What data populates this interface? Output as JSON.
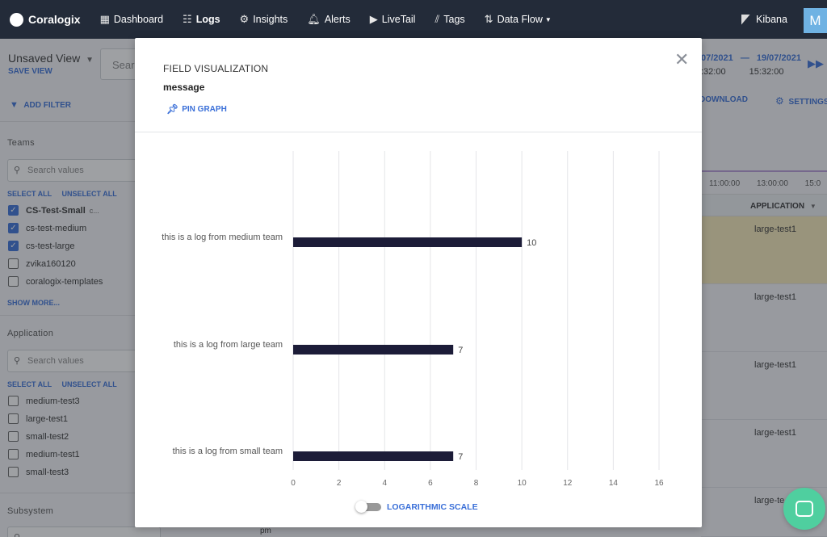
{
  "nav": {
    "brand": "Coralogix",
    "items": [
      {
        "label": "Dashboard",
        "icon": "grid-icon"
      },
      {
        "label": "Logs",
        "icon": "logs-icon",
        "active": true
      },
      {
        "label": "Insights",
        "icon": "chip-icon"
      },
      {
        "label": "Alerts",
        "icon": "bell-icon"
      },
      {
        "label": "LiveTail",
        "icon": "play-icon"
      },
      {
        "label": "Tags",
        "icon": "tags-icon"
      },
      {
        "label": "Data Flow",
        "icon": "dataflow-icon"
      }
    ],
    "kibana": "Kibana",
    "avatar": "M"
  },
  "sidebar": {
    "view_name": "Unsaved View",
    "save_view": "SAVE VIEW",
    "add_filter": "ADD FILTER",
    "teams": {
      "title": "Teams",
      "search_placeholder": "Search values",
      "select_all": "SELECT ALL",
      "unselect_all": "UNSELECT ALL",
      "items": [
        {
          "label": "CS-Test-Small",
          "suffix": "c...",
          "checked": true,
          "bold": true
        },
        {
          "label": "cs-test-medium",
          "checked": true
        },
        {
          "label": "cs-test-large",
          "checked": true
        },
        {
          "label": "zvika160120",
          "checked": false
        },
        {
          "label": "coralogix-templates",
          "checked": false
        }
      ],
      "show_more": "SHOW MORE..."
    },
    "application": {
      "title": "Application",
      "search_placeholder": "Search values",
      "select_all": "SELECT ALL",
      "unselect_all": "UNSELECT ALL",
      "items": [
        {
          "label": "medium-test3",
          "checked": false
        },
        {
          "label": "large-test1",
          "checked": false
        },
        {
          "label": "small-test2",
          "checked": false
        },
        {
          "label": "medium-test1",
          "checked": false
        },
        {
          "label": "small-test3",
          "checked": false
        }
      ]
    },
    "subsystem": {
      "title": "Subsystem"
    }
  },
  "main": {
    "search_placeholder": "Sear",
    "date_from": "07/2021",
    "date_to": "19/07/2021",
    "time_from": ":32:00",
    "time_to": "15:32:00",
    "download": "DOWNLOAD",
    "settings": "SETTINGS",
    "timeline_labels": "11:00:00 13:00:00 15:0",
    "column_header": "APPLICATION",
    "rows": [
      "large-test1",
      "large-test1",
      "large-test1",
      "large-test1",
      "large-te"
    ],
    "bottom_text": "pm"
  },
  "modal": {
    "title": "FIELD VISUALIZATION",
    "field": "message",
    "pin_graph": "PIN GRAPH",
    "log_scale_label": "LOGARITHMIC SCALE",
    "log_scale_on": false
  },
  "chart_data": {
    "type": "bar",
    "orientation": "horizontal",
    "categories": [
      "this is a log from medium team",
      "this is a log from large team",
      "this is a log from small team"
    ],
    "values": [
      10,
      7,
      7
    ],
    "xlim": [
      0,
      16
    ],
    "xticks": [
      0,
      2,
      4,
      6,
      8,
      10,
      12,
      14,
      16
    ],
    "grid": true,
    "bar_color": "#1c1c38"
  }
}
